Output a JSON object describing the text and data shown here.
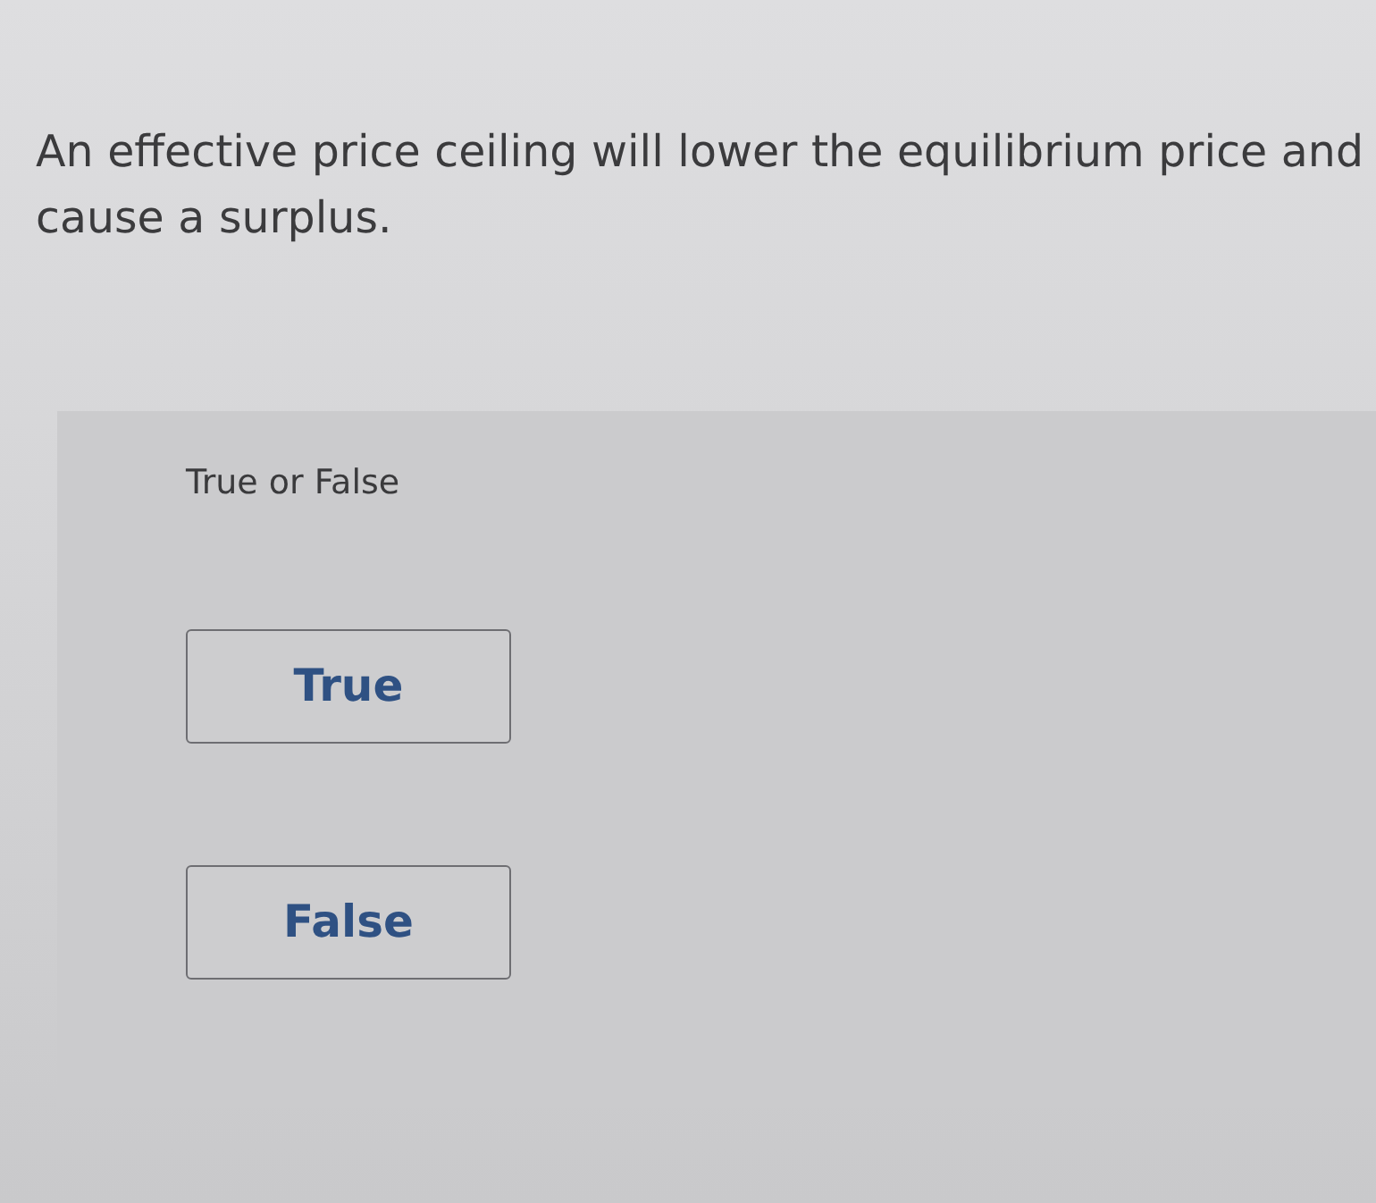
{
  "question": {
    "text": "An effective price ceiling will lower the equilibrium price and cause a surplus."
  },
  "answer_panel": {
    "prompt": "True or False",
    "choices": [
      {
        "label": "True",
        "selected": false
      },
      {
        "label": "False",
        "selected": false
      }
    ]
  }
}
